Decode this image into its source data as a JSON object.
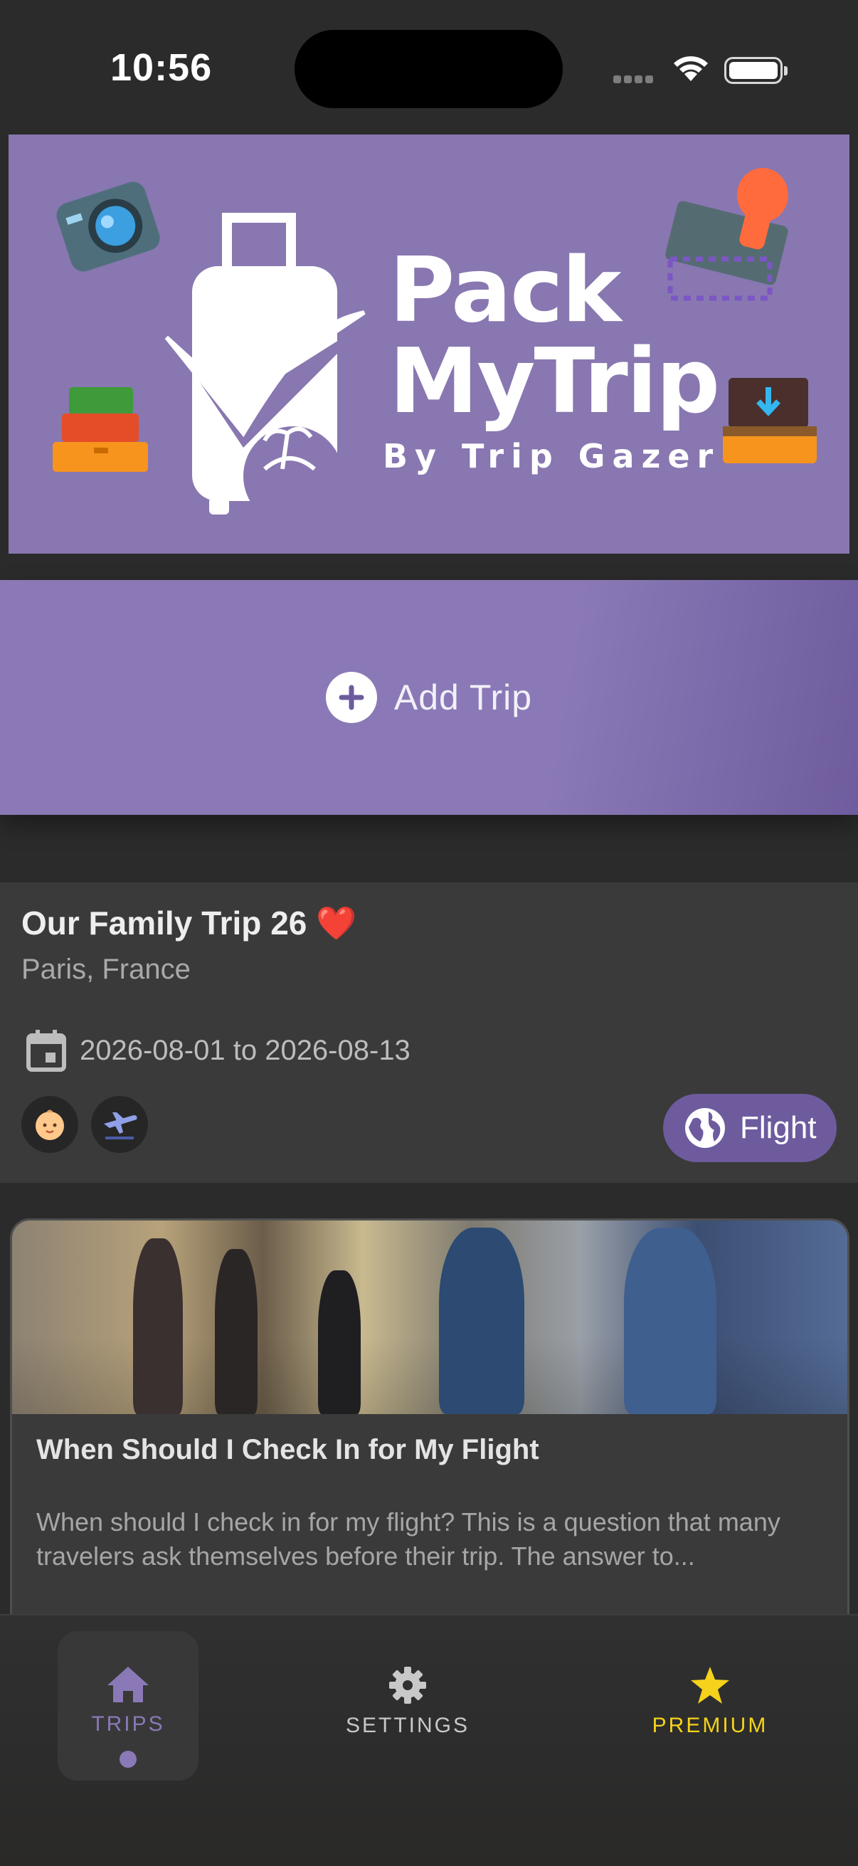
{
  "status_bar": {
    "time": "10:56"
  },
  "banner": {
    "title_line1": "Pack",
    "title_line2": "MyTrip",
    "subtitle": "By Trip Gazer"
  },
  "add_trip": {
    "label": "Add Trip"
  },
  "trip": {
    "title": "Our Family Trip 26 ❤️",
    "location": "Paris, France",
    "dates": "2026-08-01 to 2026-08-13",
    "chips": [
      "baby-icon",
      "airplane-icon"
    ],
    "flight_label": "Flight"
  },
  "article": {
    "title": "When Should I Check In for My Flight",
    "excerpt": "When should I check in for my flight? This is a question that many travelers ask themselves before their trip. The answer to..."
  },
  "nav": {
    "items": [
      {
        "label": "TRIPS",
        "icon": "home-icon",
        "color": "#8a79b6",
        "active": true
      },
      {
        "label": "SETTINGS",
        "icon": "gear-icon",
        "color": "#c8c8c8",
        "active": false
      },
      {
        "label": "PREMIUM",
        "icon": "star-icon",
        "color": "#f5d21b",
        "active": false
      }
    ]
  },
  "colors": {
    "accent": "#8a79b6",
    "accent_dark": "#6d5b9e",
    "premium": "#f5d21b",
    "background": "#2b2b2b",
    "card": "#3a3a3a"
  }
}
